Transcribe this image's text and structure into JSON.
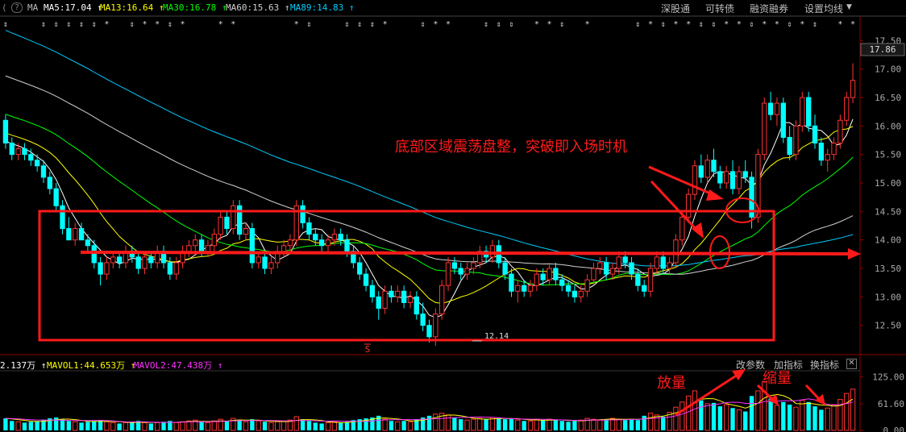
{
  "topbar": {
    "icons": [
      "(",
      "?",
      "MA"
    ],
    "ma_items": [
      {
        "label": "MA5:17.04",
        "arrow": "↑",
        "color": "#ffffff"
      },
      {
        "label": "MA13:16.64",
        "arrow": "↑",
        "color": "#ffff00"
      },
      {
        "label": "MA30:16.78",
        "arrow": "↑",
        "color": "#00ff00"
      },
      {
        "label": "MA60:15.63",
        "arrow": "↑",
        "color": "#d0d0d0"
      },
      {
        "label": "MA89:14.83",
        "arrow": "↑",
        "color": "#00ccff"
      }
    ],
    "controls": [
      "深股通",
      "可转债",
      "融资融券",
      "设置均线"
    ]
  },
  "volume_bar": {
    "items": [
      {
        "label": "2.137万",
        "arrow": "↑",
        "color": "#ffffff"
      },
      {
        "label": "MAVOL1:44.653万",
        "arrow": "↑",
        "color": "#ffff00"
      },
      {
        "label": "MAVOL2:47.438万",
        "arrow": "↑",
        "color": "#ff33ff"
      }
    ],
    "controls": [
      "改参数",
      "加指标",
      "换指标"
    ]
  },
  "price_axis": {
    "ticks": [
      "17.50",
      "17.00",
      "16.50",
      "16.00",
      "15.50",
      "15.00",
      "14.50",
      "14.00",
      "13.50",
      "13.00",
      "12.50"
    ],
    "current": "17.86"
  },
  "volume_axis": {
    "ticks": [
      "125.00",
      "61.60",
      "0.00"
    ]
  },
  "annotations": {
    "title": "底部区域震荡盘整，突破即入场时机",
    "vol_up": "放量",
    "vol_down": "缩量",
    "low_label": "12.14",
    "marker": "S"
  },
  "colors": {
    "up": "#ff3333",
    "down": "#00ffff",
    "annotation": "#ff1a1a",
    "background": "#000000"
  },
  "chart_data": {
    "type": "candlestick",
    "price_range": [
      12.1,
      17.9
    ],
    "volume_range": [
      0,
      135
    ],
    "ohlc": [
      [
        16.1,
        16.2,
        15.6,
        15.7
      ],
      [
        15.7,
        15.8,
        15.4,
        15.5
      ],
      [
        15.5,
        15.7,
        15.4,
        15.6
      ],
      [
        15.6,
        15.7,
        15.4,
        15.5
      ],
      [
        15.5,
        15.6,
        15.3,
        15.4
      ],
      [
        15.4,
        15.5,
        15.2,
        15.3
      ],
      [
        15.3,
        15.4,
        15.0,
        15.1
      ],
      [
        15.1,
        15.2,
        14.8,
        14.9
      ],
      [
        14.9,
        15.0,
        14.5,
        14.6
      ],
      [
        14.6,
        14.7,
        14.1,
        14.2
      ],
      [
        14.2,
        14.4,
        14.0,
        14.0
      ],
      [
        14.0,
        14.3,
        13.9,
        14.2
      ],
      [
        14.2,
        14.3,
        14.0,
        14.0
      ],
      [
        14.0,
        14.1,
        13.8,
        13.9
      ],
      [
        13.9,
        14.0,
        13.5,
        13.6
      ],
      [
        13.6,
        13.7,
        13.2,
        13.4
      ],
      [
        13.4,
        13.7,
        13.3,
        13.6
      ],
      [
        13.6,
        13.8,
        13.5,
        13.7
      ],
      [
        13.7,
        13.8,
        13.5,
        13.6
      ],
      [
        13.6,
        13.9,
        13.5,
        13.8
      ],
      [
        13.8,
        13.9,
        13.6,
        13.7
      ],
      [
        13.7,
        13.8,
        13.4,
        13.5
      ],
      [
        13.5,
        13.8,
        13.4,
        13.7
      ],
      [
        13.7,
        13.8,
        13.5,
        13.6
      ],
      [
        13.6,
        13.9,
        13.5,
        13.8
      ],
      [
        13.8,
        13.9,
        13.5,
        13.6
      ],
      [
        13.6,
        13.7,
        13.3,
        13.4
      ],
      [
        13.4,
        13.7,
        13.3,
        13.6
      ],
      [
        13.6,
        13.9,
        13.5,
        13.8
      ],
      [
        13.8,
        14.0,
        13.7,
        13.9
      ],
      [
        13.9,
        14.1,
        13.8,
        14.0
      ],
      [
        14.0,
        14.1,
        13.7,
        13.8
      ],
      [
        13.8,
        14.0,
        13.7,
        13.9
      ],
      [
        13.9,
        14.2,
        13.8,
        14.1
      ],
      [
        14.1,
        14.5,
        14.0,
        14.4
      ],
      [
        14.4,
        14.5,
        14.1,
        14.2
      ],
      [
        14.2,
        14.7,
        14.1,
        14.6
      ],
      [
        14.6,
        14.7,
        14.0,
        14.1
      ],
      [
        14.1,
        14.3,
        14.0,
        14.2
      ],
      [
        14.2,
        14.3,
        13.5,
        13.6
      ],
      [
        13.6,
        13.8,
        13.5,
        13.7
      ],
      [
        13.7,
        13.8,
        13.4,
        13.5
      ],
      [
        13.5,
        13.7,
        13.4,
        13.6
      ],
      [
        13.6,
        13.9,
        13.5,
        13.8
      ],
      [
        13.8,
        14.0,
        13.7,
        13.9
      ],
      [
        13.9,
        14.1,
        13.8,
        14.0
      ],
      [
        14.0,
        14.7,
        13.9,
        14.6
      ],
      [
        14.6,
        14.7,
        14.2,
        14.3
      ],
      [
        14.3,
        14.4,
        14.0,
        14.1
      ],
      [
        14.1,
        14.2,
        13.9,
        14.0
      ],
      [
        14.0,
        14.1,
        13.8,
        13.9
      ],
      [
        13.9,
        14.1,
        13.8,
        14.0
      ],
      [
        14.0,
        14.2,
        13.9,
        14.1
      ],
      [
        14.1,
        14.2,
        13.9,
        14.0
      ],
      [
        14.0,
        14.1,
        13.7,
        13.8
      ],
      [
        13.8,
        13.9,
        13.5,
        13.6
      ],
      [
        13.6,
        13.7,
        13.3,
        13.4
      ],
      [
        13.4,
        13.5,
        13.1,
        13.2
      ],
      [
        13.2,
        13.3,
        12.9,
        13.0
      ],
      [
        13.0,
        13.1,
        12.6,
        12.8
      ],
      [
        12.8,
        13.2,
        12.7,
        13.1
      ],
      [
        13.1,
        13.2,
        12.9,
        13.0
      ],
      [
        13.0,
        13.2,
        12.9,
        13.1
      ],
      [
        13.1,
        13.2,
        12.8,
        12.9
      ],
      [
        12.9,
        13.1,
        12.8,
        13.0
      ],
      [
        13.0,
        13.1,
        12.6,
        12.7
      ],
      [
        12.7,
        12.9,
        12.4,
        12.5
      ],
      [
        12.5,
        12.6,
        12.2,
        12.3
      ],
      [
        12.3,
        12.8,
        12.14,
        12.7
      ],
      [
        12.7,
        13.3,
        12.6,
        13.2
      ],
      [
        13.2,
        13.7,
        13.1,
        13.6
      ],
      [
        13.6,
        13.7,
        13.4,
        13.5
      ],
      [
        13.5,
        13.6,
        13.3,
        13.4
      ],
      [
        13.4,
        13.6,
        13.3,
        13.5
      ],
      [
        13.5,
        13.7,
        13.4,
        13.6
      ],
      [
        13.6,
        13.9,
        13.5,
        13.8
      ],
      [
        13.8,
        13.9,
        13.6,
        13.7
      ],
      [
        13.7,
        14.0,
        13.6,
        13.9
      ],
      [
        13.9,
        14.0,
        13.5,
        13.6
      ],
      [
        13.6,
        13.7,
        13.3,
        13.4
      ],
      [
        13.4,
        13.5,
        13.0,
        13.1
      ],
      [
        13.1,
        13.3,
        12.9,
        13.2
      ],
      [
        13.2,
        13.3,
        13.0,
        13.1
      ],
      [
        13.1,
        13.3,
        13.0,
        13.2
      ],
      [
        13.2,
        13.5,
        13.1,
        13.4
      ],
      [
        13.4,
        13.5,
        13.2,
        13.3
      ],
      [
        13.3,
        13.6,
        13.2,
        13.5
      ],
      [
        13.5,
        13.6,
        13.2,
        13.3
      ],
      [
        13.3,
        13.4,
        13.1,
        13.2
      ],
      [
        13.2,
        13.3,
        13.0,
        13.1
      ],
      [
        13.1,
        13.2,
        12.9,
        13.0
      ],
      [
        13.0,
        13.2,
        12.9,
        13.1
      ],
      [
        13.1,
        13.4,
        13.0,
        13.3
      ],
      [
        13.3,
        13.6,
        13.2,
        13.5
      ],
      [
        13.5,
        13.7,
        13.4,
        13.6
      ],
      [
        13.6,
        13.7,
        13.3,
        13.4
      ],
      [
        13.4,
        13.6,
        13.3,
        13.5
      ],
      [
        13.5,
        13.8,
        13.4,
        13.7
      ],
      [
        13.7,
        13.8,
        13.5,
        13.6
      ],
      [
        13.6,
        13.7,
        13.3,
        13.4
      ],
      [
        13.4,
        13.5,
        13.1,
        13.2
      ],
      [
        13.2,
        13.3,
        13.0,
        13.1
      ],
      [
        13.1,
        13.6,
        13.0,
        13.5
      ],
      [
        13.5,
        13.8,
        13.4,
        13.7
      ],
      [
        13.7,
        13.8,
        13.4,
        13.5
      ],
      [
        13.5,
        13.7,
        13.4,
        13.6
      ],
      [
        13.6,
        14.1,
        13.5,
        14.0
      ],
      [
        14.0,
        14.5,
        13.9,
        14.4
      ],
      [
        14.4,
        14.9,
        14.3,
        14.8
      ],
      [
        14.8,
        15.4,
        14.7,
        15.3
      ],
      [
        15.3,
        15.5,
        15.0,
        15.1
      ],
      [
        15.1,
        15.5,
        15.0,
        15.4
      ],
      [
        15.4,
        15.6,
        15.1,
        15.2
      ],
      [
        15.2,
        15.3,
        14.9,
        15.0
      ],
      [
        15.0,
        15.3,
        14.9,
        15.2
      ],
      [
        15.2,
        15.4,
        14.8,
        14.9
      ],
      [
        14.9,
        15.3,
        14.8,
        15.2
      ],
      [
        15.2,
        15.4,
        15.0,
        15.1
      ],
      [
        15.1,
        15.2,
        14.2,
        14.4
      ],
      [
        14.4,
        15.6,
        14.3,
        15.5
      ],
      [
        15.5,
        16.5,
        15.4,
        16.4
      ],
      [
        16.4,
        16.6,
        16.1,
        16.2
      ],
      [
        16.2,
        16.5,
        16.0,
        16.4
      ],
      [
        16.4,
        16.5,
        15.7,
        15.8
      ],
      [
        15.8,
        16.0,
        15.4,
        15.5
      ],
      [
        15.5,
        16.1,
        15.4,
        16.0
      ],
      [
        16.0,
        16.6,
        15.9,
        16.5
      ],
      [
        16.5,
        16.6,
        15.9,
        16.0
      ],
      [
        16.0,
        16.2,
        15.6,
        15.7
      ],
      [
        15.7,
        15.8,
        15.3,
        15.4
      ],
      [
        15.4,
        15.6,
        15.2,
        15.5
      ],
      [
        15.5,
        15.8,
        15.4,
        15.7
      ],
      [
        15.7,
        16.2,
        15.6,
        16.1
      ],
      [
        16.1,
        16.6,
        16.0,
        16.5
      ],
      [
        16.5,
        17.1,
        16.4,
        16.8
      ]
    ],
    "volumes": [
      28,
      22,
      20,
      18,
      20,
      22,
      25,
      28,
      30,
      26,
      22,
      20,
      18,
      20,
      22,
      24,
      20,
      18,
      16,
      18,
      20,
      22,
      18,
      16,
      18,
      20,
      22,
      18,
      20,
      22,
      24,
      20,
      18,
      22,
      26,
      22,
      28,
      24,
      20,
      26,
      22,
      20,
      18,
      20,
      22,
      24,
      32,
      26,
      22,
      18,
      16,
      18,
      20,
      18,
      20,
      24,
      26,
      28,
      30,
      34,
      26,
      22,
      20,
      22,
      20,
      26,
      30,
      34,
      38,
      40,
      36,
      30,
      26,
      24,
      26,
      28,
      26,
      30,
      28,
      26,
      28,
      24,
      22,
      22,
      26,
      24,
      26,
      24,
      22,
      20,
      22,
      24,
      28,
      26,
      24,
      26,
      28,
      26,
      24,
      26,
      24,
      34,
      40,
      36,
      32,
      42,
      54,
      66,
      80,
      92,
      70,
      62,
      64,
      56,
      60,
      52,
      48,
      44,
      80,
      92,
      114,
      74,
      58,
      66,
      60,
      54,
      70,
      66,
      56,
      48,
      52,
      60,
      72,
      86,
      96
    ],
    "ma_series": [
      {
        "name": "MA5",
        "color": "#ffffff",
        "last": 17.04
      },
      {
        "name": "MA13",
        "color": "#ffff00",
        "last": 16.64
      },
      {
        "name": "MA30",
        "color": "#00ff00",
        "last": 16.78
      },
      {
        "name": "MA60",
        "color": "#d0d0d0",
        "last": 15.63
      },
      {
        "name": "MA89",
        "color": "#00ccff",
        "last": 14.83
      }
    ],
    "consolidation_box": {
      "price_high": 14.75,
      "price_low": 12.3
    },
    "breakout_level": 13.97
  }
}
